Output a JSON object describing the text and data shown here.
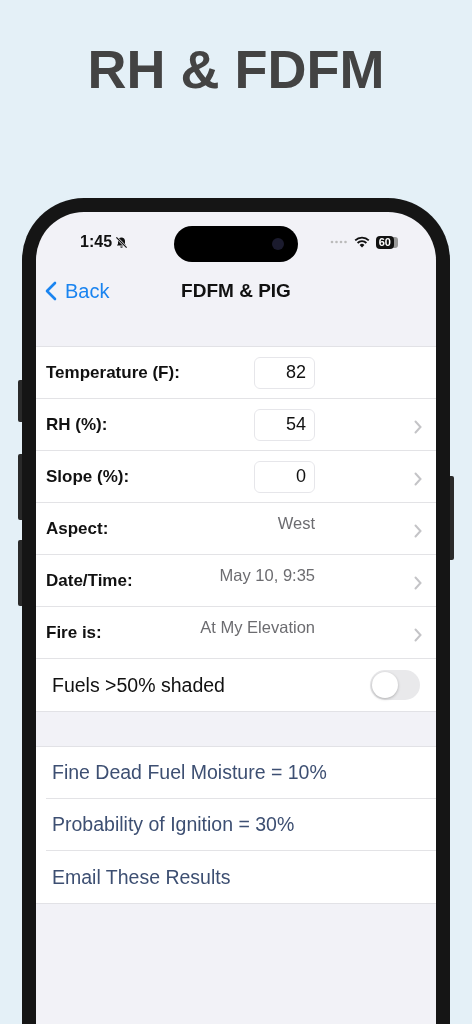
{
  "headline": "RH & FDFM",
  "status_bar": {
    "time": "1:45",
    "silent": true,
    "battery": "60"
  },
  "nav": {
    "back": "Back",
    "title": "FDFM & PIG"
  },
  "inputs": [
    {
      "kind": "field",
      "label": "Temperature (F):",
      "value": "82",
      "chevron": false
    },
    {
      "kind": "field",
      "label": "RH (%):",
      "value": "54",
      "chevron": true
    },
    {
      "kind": "field",
      "label": "Slope (%):",
      "value": "0",
      "chevron": true
    },
    {
      "kind": "picker",
      "label": "Aspect:",
      "value": "West",
      "chevron": true
    },
    {
      "kind": "picker",
      "label": "Date/Time:",
      "value": "May 10, 9:35",
      "chevron": true
    },
    {
      "kind": "picker",
      "label": "Fire is:",
      "value": "At My Elevation",
      "chevron": true
    },
    {
      "kind": "toggle",
      "label": "Fuels >50% shaded",
      "on": false
    }
  ],
  "results": [
    "Fine Dead Fuel Moisture = 10%",
    "Probability of Ignition = 30%"
  ],
  "email_button": "Email These Results"
}
